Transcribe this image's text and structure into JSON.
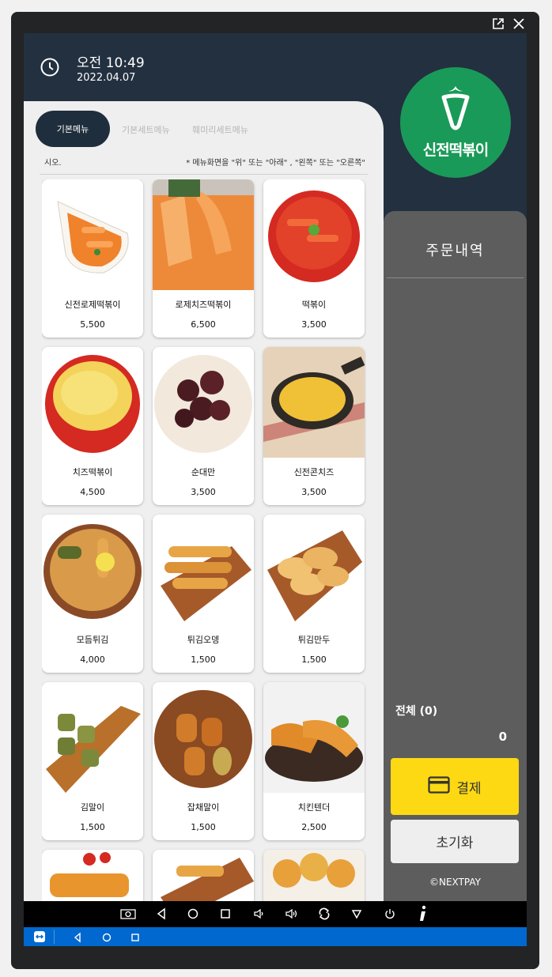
{
  "header": {
    "time": "오전 10:49",
    "date": "2022.04.07"
  },
  "brand": {
    "name": "신전떡볶이",
    "color": "#1a9a58"
  },
  "tabs": [
    {
      "label": "기본메뉴",
      "active": true
    },
    {
      "label": "기본세트메뉴",
      "active": false
    },
    {
      "label": "훼미리세트메뉴",
      "active": false
    }
  ],
  "notice": {
    "left": "시오.",
    "right": "* 메뉴화면을 \"위\" 또는 \"아래\" , \"왼쪽\" 또는 \"오른쪽\""
  },
  "menu": [
    {
      "name": "신전로제떡볶이",
      "price": "5,500"
    },
    {
      "name": "로제치즈떡볶이",
      "price": "6,500"
    },
    {
      "name": "떡볶이",
      "price": "3,500"
    },
    {
      "name": "치즈떡볶이",
      "price": "4,500"
    },
    {
      "name": "순대만",
      "price": "3,500"
    },
    {
      "name": "신전콘치즈",
      "price": "3,500"
    },
    {
      "name": "모듬튀김",
      "price": "4,000"
    },
    {
      "name": "튀김오뎅",
      "price": "1,500"
    },
    {
      "name": "튀김만두",
      "price": "1,500"
    },
    {
      "name": "김말이",
      "price": "1,500"
    },
    {
      "name": "잡채말이",
      "price": "1,500"
    },
    {
      "name": "치킨텐더",
      "price": "2,500"
    },
    {
      "name": "",
      "price": ""
    },
    {
      "name": "",
      "price": ""
    },
    {
      "name": "",
      "price": ""
    }
  ],
  "order": {
    "title": "주문내역",
    "total_label": "전체 (0)",
    "total_value": "0",
    "pay_label": "결제",
    "reset_label": "초기화",
    "copyright": "©NEXTPAY"
  },
  "colors": {
    "header_bg": "#233040",
    "pay_button": "#fcd913",
    "order_panel": "#5d5d5d",
    "taskbar": "#0068cf"
  },
  "icons": [
    "clock-icon",
    "external-link-icon",
    "close-icon",
    "credit-card-icon",
    "screenshot-icon",
    "back-icon",
    "home-icon",
    "recents-icon",
    "volume-down-icon",
    "volume-up-icon",
    "rotate-icon",
    "hide-bar-icon",
    "power-icon",
    "info-icon",
    "remote-icon"
  ]
}
